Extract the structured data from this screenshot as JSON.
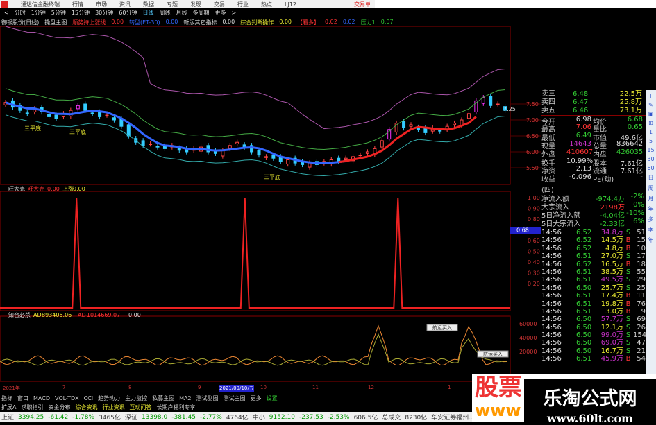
{
  "menubar": {
    "app_title": "通达信金融终端",
    "items": [
      "行情",
      "市场",
      "资讯",
      "数据",
      "专题",
      "发现",
      "交易",
      "行业",
      "热点",
      "LJ12"
    ],
    "trade": "交易单"
  },
  "toolbar": {
    "items": [
      "<",
      "分时",
      "1分钟",
      "5分钟",
      "15分钟",
      "30分钟",
      "60分钟",
      "日线",
      "周线",
      "月线",
      "多周期",
      "更多",
      ">"
    ],
    "active": "日线"
  },
  "indicator_bar": [
    {
      "text": "御银股份(日线)",
      "color": "#ddd"
    },
    {
      "text": "操盘主图",
      "color": "#ddd"
    },
    {
      "text": "顺势持上涨线",
      "color": "#f33"
    },
    {
      "text": "0.00",
      "color": "#f33"
    },
    {
      "text": "转型(ET-30)",
      "color": "#36f"
    },
    {
      "text": "0.00",
      "color": "#36f"
    },
    {
      "text": "新版其它指标",
      "color": "#ddd"
    },
    {
      "text": "0.00",
      "color": "#ddd"
    },
    {
      "text": "综合判断操作",
      "color": "#ee3"
    },
    {
      "text": "0.00",
      "color": "#ee3"
    },
    {
      "text": "【看多】",
      "color": "#f33"
    },
    {
      "text": "0.02",
      "color": "#f33"
    },
    {
      "text": "0.02",
      "color": "#36f"
    },
    {
      "text": "压力1",
      "color": "#3c3"
    },
    {
      "text": "0.07",
      "color": "#3c3"
    }
  ],
  "main_chart": {
    "price_axis": [
      "7.50",
      "7.00",
      "6.50",
      "6.00",
      "5.50"
    ],
    "annotations": [
      "三平底",
      "三平底",
      "三平底",
      "7.25"
    ],
    "closes": [
      7.55,
      7.4,
      7.3,
      7.2,
      7.35,
      7.25,
      7.1,
      7.05,
      7.2,
      7.3,
      7.45,
      7.3,
      7.2,
      7.1,
      7.15,
      7.0,
      6.8,
      6.5,
      6.3,
      6.2,
      6.25,
      6.15,
      6.1,
      6.2,
      6.05,
      6.0,
      6.1,
      6.15,
      6.0,
      5.95,
      6.05,
      6.2,
      6.3,
      6.15,
      6.0,
      5.9,
      5.85,
      5.8,
      5.7,
      5.75,
      5.65,
      5.6,
      5.65,
      5.6,
      5.7,
      5.75,
      5.7,
      5.8,
      5.85,
      5.9,
      6.0,
      6.1,
      6.35,
      6.7,
      6.9,
      6.75,
      6.85,
      6.7,
      6.6,
      6.75,
      6.65,
      6.8,
      6.9,
      7.0,
      7.2,
      7.6,
      7.7,
      7.45,
      7.5,
      7.3
    ]
  },
  "sub1": {
    "title": "旺大売",
    "label1": "旺大売",
    "v1": "0.00",
    "label2": "上涨",
    "v2": "0.00",
    "axis": [
      "1.00",
      "0.90",
      "0.80",
      "0.68",
      "0.60",
      "0.50",
      "0.40",
      "0.30",
      "0.20"
    ],
    "current": "0.68",
    "spikes": [
      0.15,
      0.48,
      0.78
    ]
  },
  "sub2": {
    "title": "知合必杀",
    "label1": "AD",
    "v1": "893405.06",
    "label2": "AD",
    "v2": "-1014669.07",
    "v3": "0.00",
    "axis": [
      "60000",
      "40000",
      "20000"
    ],
    "tips": [
      "航运买入",
      "航运买入"
    ]
  },
  "date_axis": [
    "2021年",
    "7",
    "8",
    "9",
    "2021/09/10/五",
    "10",
    "11",
    "12",
    "1"
  ],
  "order_book": [
    {
      "l": "卖三",
      "p": "6.48",
      "v": "22.5万"
    },
    {
      "l": "卖四",
      "p": "6.47",
      "v": "25.8万"
    },
    {
      "l": "卖五",
      "p": "6.46",
      "v": "73.1万"
    }
  ],
  "quote": [
    {
      "l1": "今开",
      "v1": "6.98",
      "c1": "#ddd",
      "l2": "均价",
      "v2": "6.68",
      "c2": "#3c3"
    },
    {
      "l1": "最高",
      "v1": "7.06",
      "c1": "#f33",
      "l2": "量比",
      "v2": "0.65",
      "c2": "#3c3"
    },
    {
      "l1": "最低",
      "v1": "6.49",
      "c1": "#3c3",
      "l2": "市值",
      "v2": "49.6亿",
      "c2": "#ddd"
    },
    {
      "l1": "现量",
      "v1": "14643",
      "c1": "#c3c",
      "l2": "总量",
      "v2": "836642",
      "c2": "#ddd"
    },
    {
      "l1": "外盘",
      "v1": "410607",
      "c1": "#f33",
      "l2": "内盘",
      "v2": "426035",
      "c2": "#3c3"
    },
    {
      "l1": "换手",
      "v1": "10.99%",
      "c1": "#ddd",
      "l2": "股本",
      "v2": "7.61亿",
      "c2": "#ddd"
    },
    {
      "l1": "净资",
      "v1": "2.13",
      "c1": "#ddd",
      "l2": "流通",
      "v2": "7.61亿",
      "c2": "#ddd"
    },
    {
      "l1": "收益(四)",
      "v1": "-0.096",
      "c1": "#ddd",
      "l2": "PE(动)",
      "v2": "-",
      "c2": "#ddd"
    }
  ],
  "flow": [
    {
      "l": "净流入额",
      "v": "-974.4万",
      "p": "-2%"
    },
    {
      "l": "大宗流入",
      "v": "2198万",
      "p": "0%"
    },
    {
      "l": "5日净流入额",
      "v": "-4.04亿",
      "p": "-10%"
    },
    {
      "l": "5日大宗流入",
      "v": "-2.33亿",
      "p": "6%"
    }
  ],
  "trades": [
    [
      "14:56",
      "6.52",
      "34.8万",
      "S",
      "51"
    ],
    [
      "14:56",
      "6.52",
      "14.5万",
      "B",
      "15"
    ],
    [
      "14:56",
      "6.52",
      "4.8万",
      "B",
      "10"
    ],
    [
      "14:56",
      "6.51",
      "27.0万",
      "S",
      "17"
    ],
    [
      "14:56",
      "6.52",
      "16.5万",
      "B",
      "18"
    ],
    [
      "14:56",
      "6.51",
      "38.5万",
      "S",
      "55"
    ],
    [
      "14:56",
      "6.51",
      "49.5万",
      "S",
      "29"
    ],
    [
      "14:56",
      "6.50",
      "25.7万",
      "S",
      "25"
    ],
    [
      "14:56",
      "6.51",
      "17.4万",
      "B",
      "11"
    ],
    [
      "14:56",
      "6.51",
      "19.8万",
      "B",
      "76"
    ],
    [
      "14:56",
      "6.51",
      "3.0万",
      "B",
      "9"
    ],
    [
      "14:56",
      "6.50",
      "57.7万",
      "S",
      "69"
    ],
    [
      "14:56",
      "6.50",
      "12.1万",
      "S",
      "26"
    ],
    [
      "14:56",
      "6.50",
      "99.0万",
      "S",
      "154"
    ],
    [
      "14:56",
      "6.50",
      "69.0万",
      "S",
      "47"
    ],
    [
      "14:56",
      "6.50",
      "16.7万",
      "S",
      "21"
    ],
    [
      "14:56",
      "6.51",
      "45.9万",
      "B",
      "54"
    ]
  ],
  "side_icons": [
    "+",
    "✎",
    "▣",
    "⊞",
    "1",
    "5",
    "15",
    "30",
    "60",
    "日",
    "周",
    "月",
    "年",
    "多",
    "季",
    "年"
  ],
  "tabs1": [
    "指标",
    "窗口",
    "MACD",
    "VOL-TDX",
    "CCI",
    "趋势动力",
    "主力监控",
    "私募主图",
    "MA2",
    "测试副图",
    "测试主图",
    "更多",
    "设置"
  ],
  "tabs2": [
    "扩展A",
    "求职指引",
    "资金分布",
    "综合资讯",
    "行业资讯",
    "互动问答",
    "长期户福利专享"
  ],
  "status": [
    {
      "t": "上证",
      "c": "#333"
    },
    {
      "t": "3394.25",
      "c": "#090"
    },
    {
      "t": "-61.42",
      "c": "#090"
    },
    {
      "t": "-1.78%",
      "c": "#090"
    },
    {
      "t": "3465亿",
      "c": "#333"
    },
    {
      "t": "深证",
      "c": "#333"
    },
    {
      "t": "13398.0",
      "c": "#090"
    },
    {
      "t": "-381.45",
      "c": "#090"
    },
    {
      "t": "-2.77%",
      "c": "#090"
    },
    {
      "t": "4764亿",
      "c": "#333"
    },
    {
      "t": "中小",
      "c": "#333"
    },
    {
      "t": "9152.10",
      "c": "#090"
    },
    {
      "t": "-237.53",
      "c": "#090"
    },
    {
      "t": "-2.53%",
      "c": "#090"
    },
    {
      "t": "606.5亿",
      "c": "#333"
    },
    {
      "t": "总成交",
      "c": "#333"
    },
    {
      "t": "8230亿",
      "c": "#333"
    },
    {
      "t": "华安证券福州...",
      "c": "#333"
    }
  ],
  "watermark": {
    "left_text": "股票",
    "left_url": "www",
    "title": "乐淘公式网",
    "url": "www.60lt.com"
  }
}
